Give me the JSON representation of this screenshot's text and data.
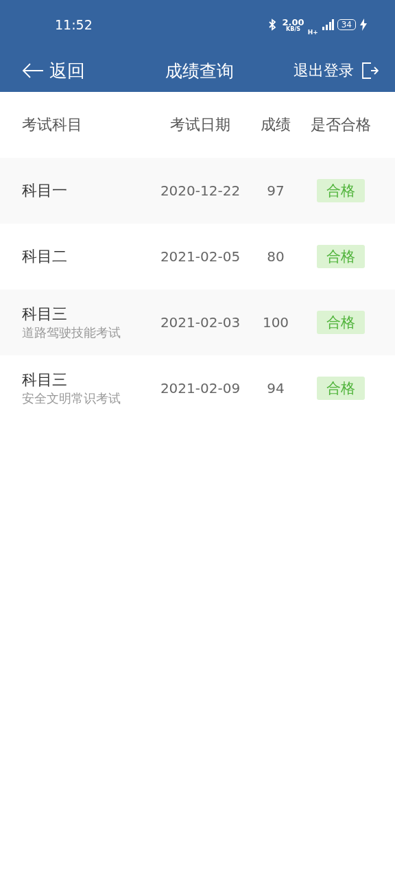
{
  "status_bar": {
    "time": "11:52",
    "speed": "2.00",
    "speed_unit": "KB/S",
    "network": "H+",
    "battery": "34",
    "charging": true
  },
  "nav": {
    "back": "返回",
    "title": "成绩查询",
    "logout": "退出登录"
  },
  "table": {
    "columns": [
      "考试科目",
      "考试日期",
      "成绩",
      "是否合格"
    ],
    "rows": [
      {
        "subject": "科目一",
        "detail": null,
        "date": "2020-12-22",
        "score": "97",
        "result": "合格",
        "passed": true
      },
      {
        "subject": "科目二",
        "detail": null,
        "date": "2021-02-05",
        "score": "80",
        "result": "合格",
        "passed": true
      },
      {
        "subject": "科目三",
        "detail": "道路驾驶技能考试",
        "date": "2021-02-03",
        "score": "100",
        "result": "合格",
        "passed": true
      },
      {
        "subject": "科目三",
        "detail": "安全文明常识考试",
        "date": "2021-02-09",
        "score": "94",
        "result": "合格",
        "passed": true
      }
    ]
  }
}
